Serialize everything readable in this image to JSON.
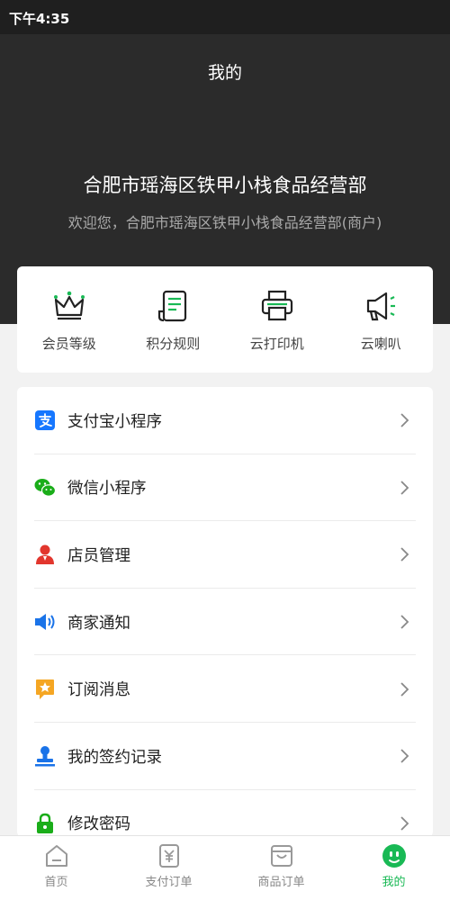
{
  "status_bar": {
    "time": "下午4:35"
  },
  "header": {
    "title": "我的",
    "shop_name": "合肥市瑶海区铁甲小栈食品经营部",
    "welcome": "欢迎您，合肥市瑶海区铁甲小栈食品经营部(商户)"
  },
  "quick_actions": [
    {
      "label": "会员等级",
      "icon": "crown-icon"
    },
    {
      "label": "积分规则",
      "icon": "document-icon"
    },
    {
      "label": "云打印机",
      "icon": "printer-icon"
    },
    {
      "label": "云喇叭",
      "icon": "megaphone-icon"
    }
  ],
  "menu": [
    {
      "label": "支付宝小程序",
      "icon": "alipay-icon",
      "color": "#1677ff"
    },
    {
      "label": "微信小程序",
      "icon": "wechat-icon",
      "color": "#1aad19"
    },
    {
      "label": "店员管理",
      "icon": "staff-icon",
      "color": "#e2362d"
    },
    {
      "label": "商家通知",
      "icon": "speaker-icon",
      "color": "#1a73e8"
    },
    {
      "label": "订阅消息",
      "icon": "star-message-icon",
      "color": "#f5a623"
    },
    {
      "label": "我的签约记录",
      "icon": "stamp-icon",
      "color": "#1a73e8"
    },
    {
      "label": "修改密码",
      "icon": "lock-icon",
      "color": "#1aad19"
    }
  ],
  "tabbar": [
    {
      "label": "首页",
      "icon": "home-icon",
      "active": false
    },
    {
      "label": "支付订单",
      "icon": "yen-receipt-icon",
      "active": false
    },
    {
      "label": "商品订单",
      "icon": "bag-icon",
      "active": false
    },
    {
      "label": "我的",
      "icon": "smile-icon",
      "active": true
    }
  ],
  "colors": {
    "accent": "#19b955",
    "header_bg": "#2b2b2b"
  }
}
